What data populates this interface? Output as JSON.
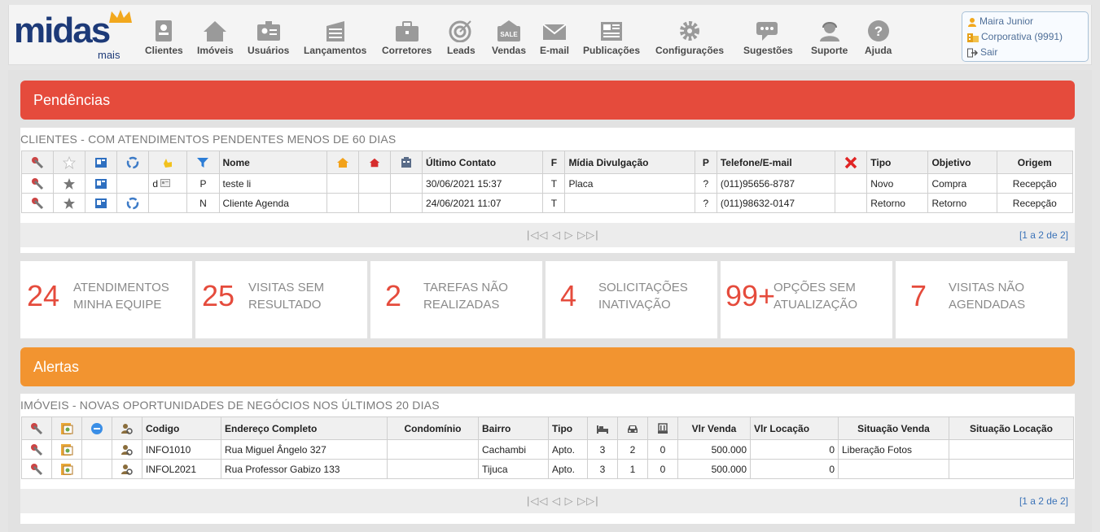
{
  "brand": {
    "name": "midas",
    "sub": "mais"
  },
  "nav": [
    {
      "label": "Clientes",
      "icon": "clients-icon"
    },
    {
      "label": "Imóveis",
      "icon": "house-icon"
    },
    {
      "label": "Usuários",
      "icon": "users-icon"
    },
    {
      "label": "Lançamentos",
      "icon": "building-icon"
    },
    {
      "label": "Corretores",
      "icon": "briefcase-icon"
    },
    {
      "label": "Leads",
      "icon": "target-icon"
    },
    {
      "label": "Vendas",
      "icon": "sale-icon"
    },
    {
      "label": "E-mail",
      "icon": "envelope-icon"
    },
    {
      "label": "Publicações",
      "icon": "newspaper-icon"
    },
    {
      "label": "Configurações",
      "icon": "gear-icon"
    },
    {
      "label": "Sugestões",
      "icon": "chat-icon"
    },
    {
      "label": "Suporte",
      "icon": "support-icon"
    },
    {
      "label": "Ajuda",
      "icon": "help-icon"
    }
  ],
  "user": {
    "name": "Maira Junior",
    "company": "Corporativa (9991)",
    "logout": "Sair"
  },
  "pendencias": {
    "banner": "Pendências",
    "section_title": "CLIENTES - COM ATENDIMENTOS PENDENTES MENOS DE 60 DIAS",
    "headers": [
      "Nome",
      "Último Contato",
      "F",
      "Mídia Divulgação",
      "P",
      "Telefone/E-mail",
      "Tipo",
      "Objetivo",
      "Origem"
    ],
    "rows": [
      {
        "flag": "d",
        "status": "P",
        "nome": "teste li",
        "ultimo": "30/06/2021 15:37",
        "f": "T",
        "midia": "Placa",
        "p": "?",
        "telefone": "(011)95656-8787",
        "tipo": "Novo",
        "objetivo": "Compra",
        "origem": "Recepção"
      },
      {
        "flag": "",
        "status": "N",
        "nome": "Cliente Agenda",
        "ultimo": "24/06/2021 11:07",
        "f": "T",
        "midia": "",
        "p": "?",
        "telefone": "(011)98632-0147",
        "tipo": "Retorno",
        "objetivo": "Retorno",
        "origem": "Recepção"
      }
    ],
    "pager": {
      "controls": "|◁◁  ◁  ▷  ▷▷|",
      "count": "[1 a 2 de 2]"
    }
  },
  "stats": [
    {
      "num": "24",
      "label": "ATENDIMENTOS MINHA EQUIPE"
    },
    {
      "num": "25",
      "label": "VISITAS SEM RESULTADO"
    },
    {
      "num": "2",
      "label": "TAREFAS NÃO REALIZADAS"
    },
    {
      "num": "4",
      "label": "SOLICITAÇÕES INATIVAÇÃO"
    },
    {
      "num": "99+",
      "label": "OPÇÕES SEM ATUALIZAÇÃO"
    },
    {
      "num": "7",
      "label": "VISITAS NÃO AGENDADAS"
    }
  ],
  "alertas": {
    "banner": "Alertas",
    "section_title": "IMÓVEIS - NOVAS OPORTUNIDADES DE NEGÓCIOS NOS ÚLTIMOS 20 DIAS",
    "headers": [
      "Codigo",
      "Endereço Completo",
      "Condomínio",
      "Bairro",
      "Tipo",
      "Vlr Venda",
      "Vlr Locação",
      "Situação Venda",
      "Situação Locação"
    ],
    "rows": [
      {
        "codigo": "INFO1010",
        "endereco": "Rua Miguel Ângelo 327",
        "condominio": "",
        "bairro": "Cachambi",
        "tipo": "Apto.",
        "q": "3",
        "v": "2",
        "d": "0",
        "venda": "500.000",
        "locacao": "0",
        "sit_venda": "Liberação Fotos",
        "sit_locacao": ""
      },
      {
        "codigo": "INFOL2021",
        "endereco": "Rua Professor Gabizo 133",
        "condominio": "",
        "bairro": "Tijuca",
        "tipo": "Apto.",
        "q": "3",
        "v": "1",
        "d": "0",
        "venda": "500.000",
        "locacao": "0",
        "sit_venda": "",
        "sit_locacao": ""
      }
    ],
    "pager": {
      "controls": "|◁◁  ◁  ▷  ▷▷|",
      "count": "[1 a 2 de 2]"
    }
  }
}
